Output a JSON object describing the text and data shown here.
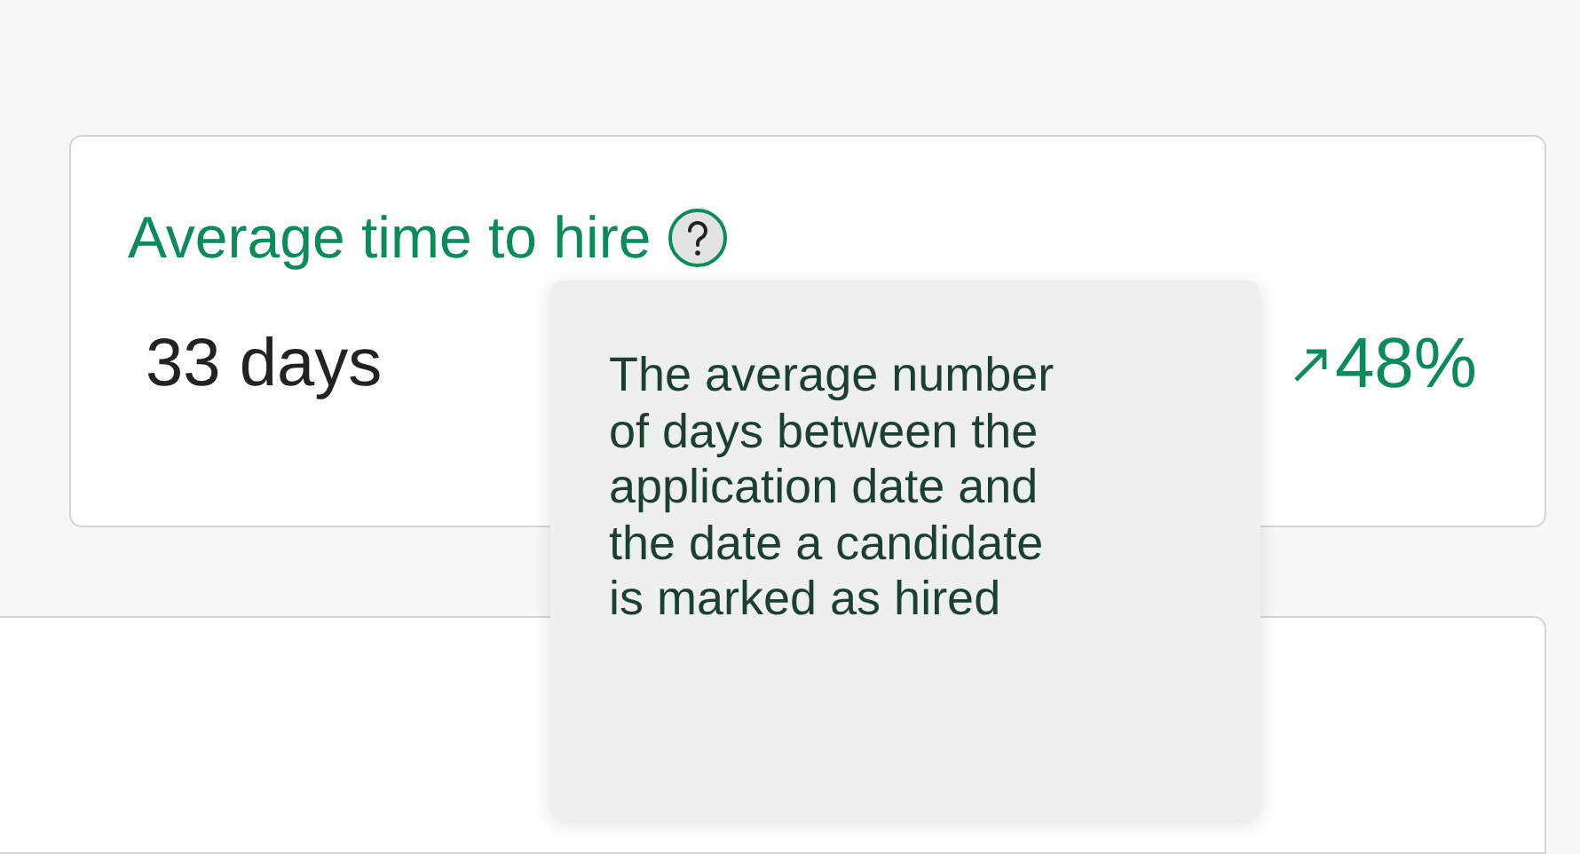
{
  "metric_card": {
    "title": "Average time to hire",
    "value": "33 days",
    "trend": {
      "change": "48%"
    }
  },
  "tooltip": {
    "text": "The average number of days between the application date and the date a candidate is marked as hired"
  }
}
